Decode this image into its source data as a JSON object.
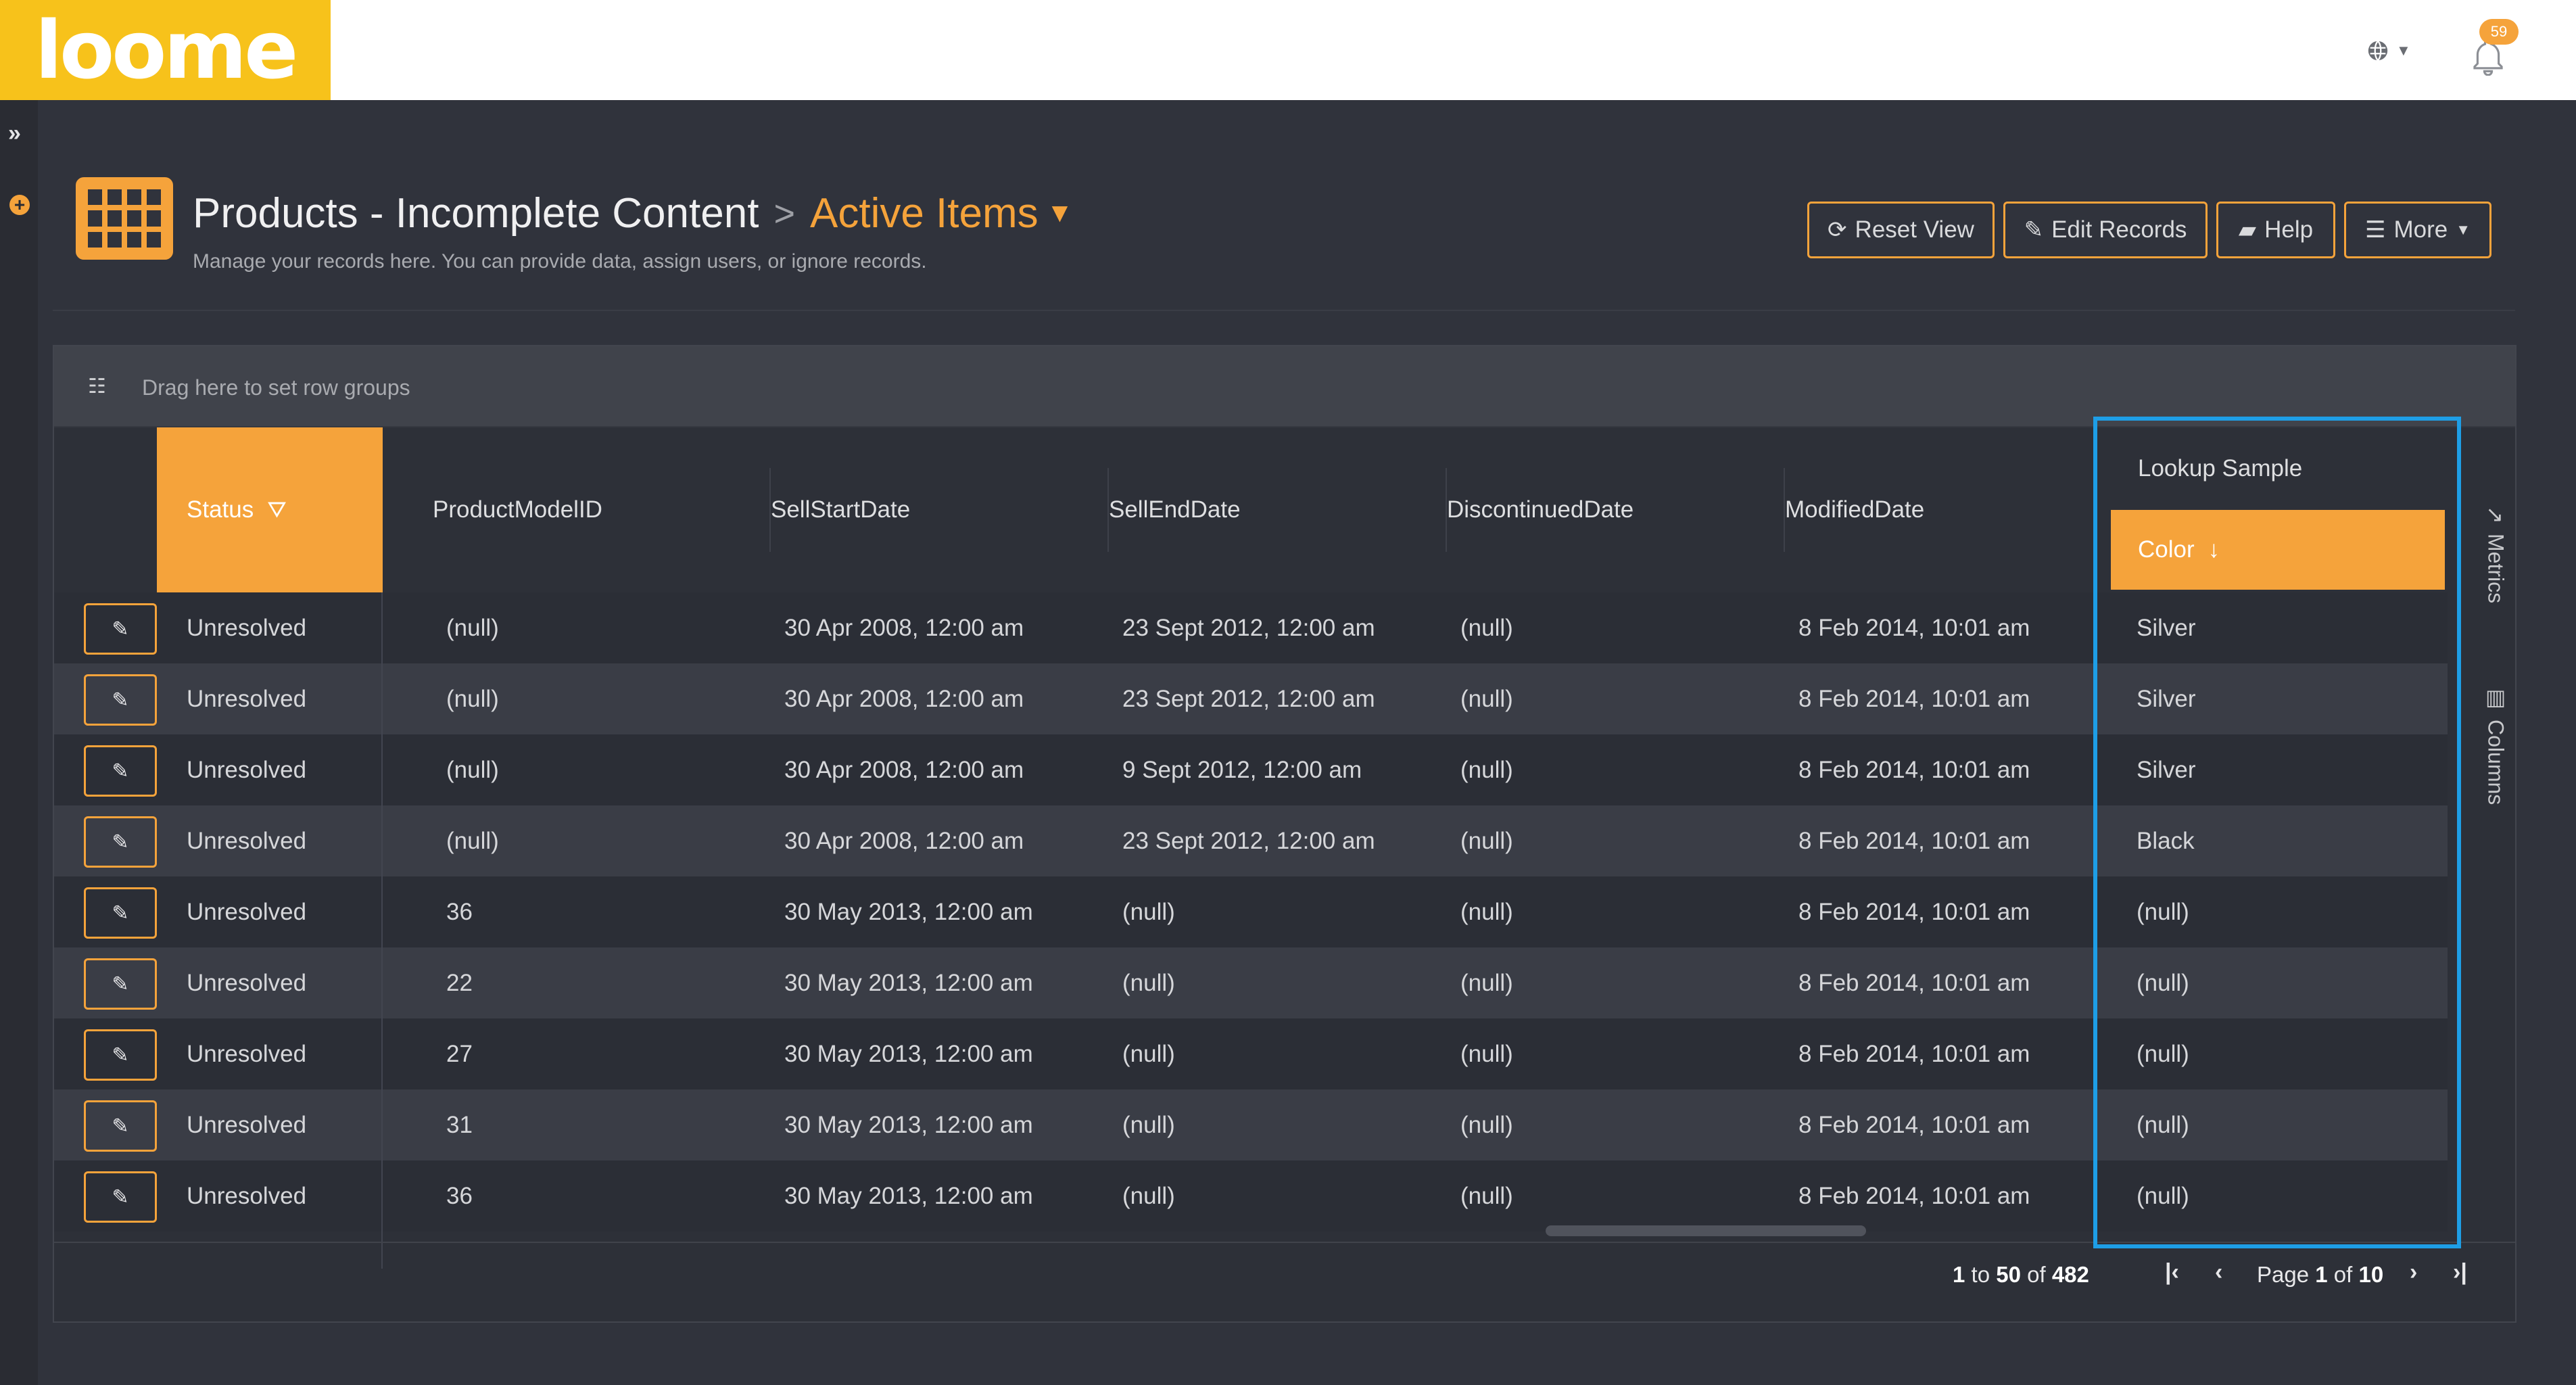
{
  "app": {
    "logo_text": "loome",
    "notification_count": "59",
    "globe_icon": "globe-icon",
    "bell_icon": "bell-icon"
  },
  "rail": {
    "expand_glyph": "»",
    "add_glyph": "+"
  },
  "header": {
    "title": "Products - Incomplete Content",
    "separator": ">",
    "view_name": "Active Items",
    "subtitle": "Manage your records here. You can provide data, assign users, or ignore records."
  },
  "toolbar": {
    "reset_label": "Reset View",
    "edit_label": "Edit Records",
    "help_label": "Help",
    "more_label": "More"
  },
  "grid": {
    "group_placeholder": "Drag here to set row groups",
    "columns": {
      "status": "Status",
      "product_model_id": "ProductModelID",
      "sell_start": "SellStartDate",
      "sell_end": "SellEndDate",
      "discontinued": "DiscontinuedDate",
      "modified": "ModifiedDate",
      "lookup_group": "Lookup Sample",
      "color": "Color"
    },
    "side_tabs": {
      "metrics": "Metrics",
      "columns": "Columns"
    },
    "rows": [
      {
        "status": "Unresolved",
        "model": "(null)",
        "start": "30 Apr 2008, 12:00 am",
        "end": "23 Sept 2012, 12:00 am",
        "disc": "(null)",
        "mod": "8 Feb 2014, 10:01 am",
        "color": "Silver"
      },
      {
        "status": "Unresolved",
        "model": "(null)",
        "start": "30 Apr 2008, 12:00 am",
        "end": "23 Sept 2012, 12:00 am",
        "disc": "(null)",
        "mod": "8 Feb 2014, 10:01 am",
        "color": "Silver"
      },
      {
        "status": "Unresolved",
        "model": "(null)",
        "start": "30 Apr 2008, 12:00 am",
        "end": "9 Sept 2012, 12:00 am",
        "disc": "(null)",
        "mod": "8 Feb 2014, 10:01 am",
        "color": "Silver"
      },
      {
        "status": "Unresolved",
        "model": "(null)",
        "start": "30 Apr 2008, 12:00 am",
        "end": "23 Sept 2012, 12:00 am",
        "disc": "(null)",
        "mod": "8 Feb 2014, 10:01 am",
        "color": "Black"
      },
      {
        "status": "Unresolved",
        "model": "36",
        "start": "30 May 2013, 12:00 am",
        "end": "(null)",
        "disc": "(null)",
        "mod": "8 Feb 2014, 10:01 am",
        "color": "(null)"
      },
      {
        "status": "Unresolved",
        "model": "22",
        "start": "30 May 2013, 12:00 am",
        "end": "(null)",
        "disc": "(null)",
        "mod": "8 Feb 2014, 10:01 am",
        "color": "(null)"
      },
      {
        "status": "Unresolved",
        "model": "27",
        "start": "30 May 2013, 12:00 am",
        "end": "(null)",
        "disc": "(null)",
        "mod": "8 Feb 2014, 10:01 am",
        "color": "(null)"
      },
      {
        "status": "Unresolved",
        "model": "31",
        "start": "30 May 2013, 12:00 am",
        "end": "(null)",
        "disc": "(null)",
        "mod": "8 Feb 2014, 10:01 am",
        "color": "(null)"
      },
      {
        "status": "Unresolved",
        "model": "36",
        "start": "30 May 2013, 12:00 am",
        "end": "(null)",
        "disc": "(null)",
        "mod": "8 Feb 2014, 10:01 am",
        "color": "(null)"
      }
    ]
  },
  "pager": {
    "from": "1",
    "to_word": "to",
    "to": "50",
    "of_word": "of",
    "total": "482",
    "page_word": "Page",
    "page": "1",
    "page_of_word": "of",
    "pages": "10"
  },
  "colors": {
    "accent": "#f5a33b",
    "logo_bg": "#f7c21b",
    "background": "#30333c",
    "highlight": "#1e9ee6"
  }
}
